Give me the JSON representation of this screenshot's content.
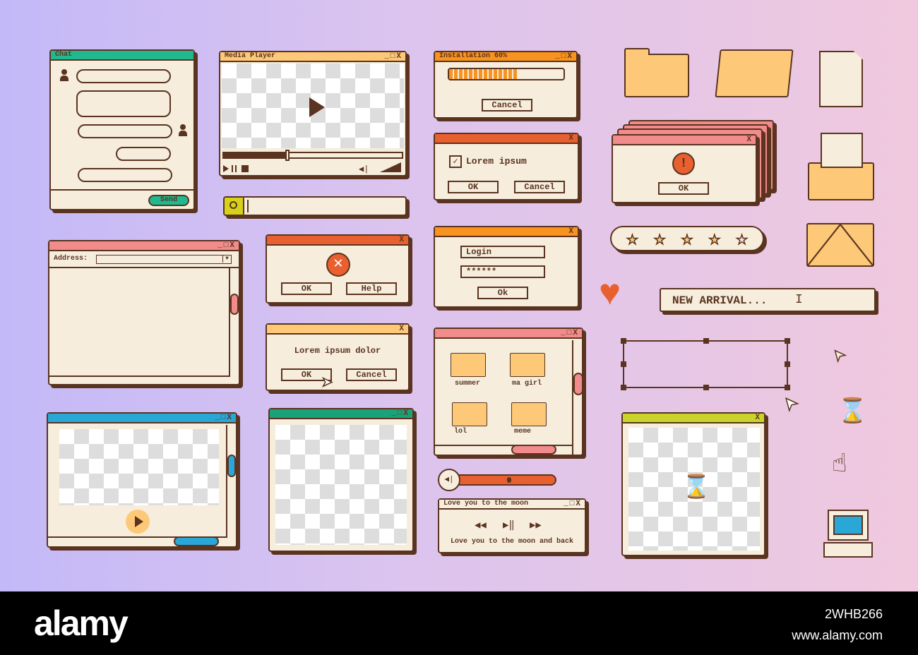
{
  "colors": {
    "outline": "#5a3420",
    "window": "#f6eddc",
    "teal": "#1fb88f",
    "peach": "#fdc978",
    "orange": "#f7931e",
    "red": "#e8602f",
    "pink": "#f28b8b",
    "green": "#1aa37a",
    "blue": "#29a8d8",
    "lime": "#c8d42a"
  },
  "chat": {
    "title": "Chat",
    "send": "Send"
  },
  "media_player": {
    "title": "Media Player",
    "progress_percent": 36,
    "icons": [
      "play-icon",
      "pause-icon",
      "stop-icon",
      "speaker-icon",
      "volume-icon"
    ]
  },
  "search": {
    "icon": "search-icon",
    "value": ""
  },
  "installation": {
    "title": "Installation 60%",
    "progress_percent": 60,
    "cancel": "Cancel"
  },
  "checkbox_dialog": {
    "label": "Lorem ipsum",
    "checked": true,
    "ok": "OK",
    "cancel": "Cancel"
  },
  "login_dialog": {
    "login": "Login",
    "password": "******",
    "ok": "Ok"
  },
  "browser": {
    "address_label": "Address:",
    "address_value": ""
  },
  "error_dialog": {
    "ok": "OK",
    "help": "Help"
  },
  "confirm_dialog": {
    "message": "Lorem ipsum dolor",
    "ok": "OK",
    "cancel": "Cancel"
  },
  "folders_window": {
    "folders": [
      "summer",
      "ma girl",
      "lol",
      "meme"
    ]
  },
  "volume": {
    "level_percent": 45
  },
  "music": {
    "title": "Love you to the moon",
    "subtitle": "Love you to the moon and back"
  },
  "alert": {
    "ok": "OK"
  },
  "rating": {
    "value": 4,
    "max": 5
  },
  "ticker": {
    "text": "NEW ARRIVAL..."
  },
  "window_controls": "_□X",
  "close": "X",
  "watermark": {
    "logo": "alamy",
    "url": "www.alamy.com",
    "image_id": "2WHB266"
  }
}
